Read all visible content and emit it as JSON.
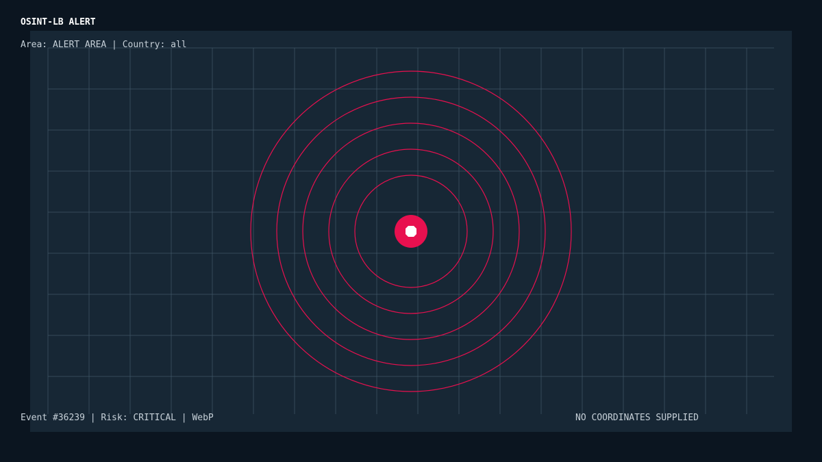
{
  "header": {
    "title": "OSINT-LB ALERT",
    "subtitle": "Area: ALERT AREA | Country: all"
  },
  "footer": {
    "event_info": "Event #36239 | Risk: CRITICAL | WebP",
    "coordinates_status": "NO COORDINATES SUPPLIED"
  },
  "colors": {
    "background": "#0b1520",
    "panel": "#172735",
    "grid": "#3f5565",
    "alert": "#e8104f",
    "marker_core": "#ffffff"
  },
  "alert_marker": {
    "icon": "alert-target-icon",
    "ring_count": 5
  }
}
